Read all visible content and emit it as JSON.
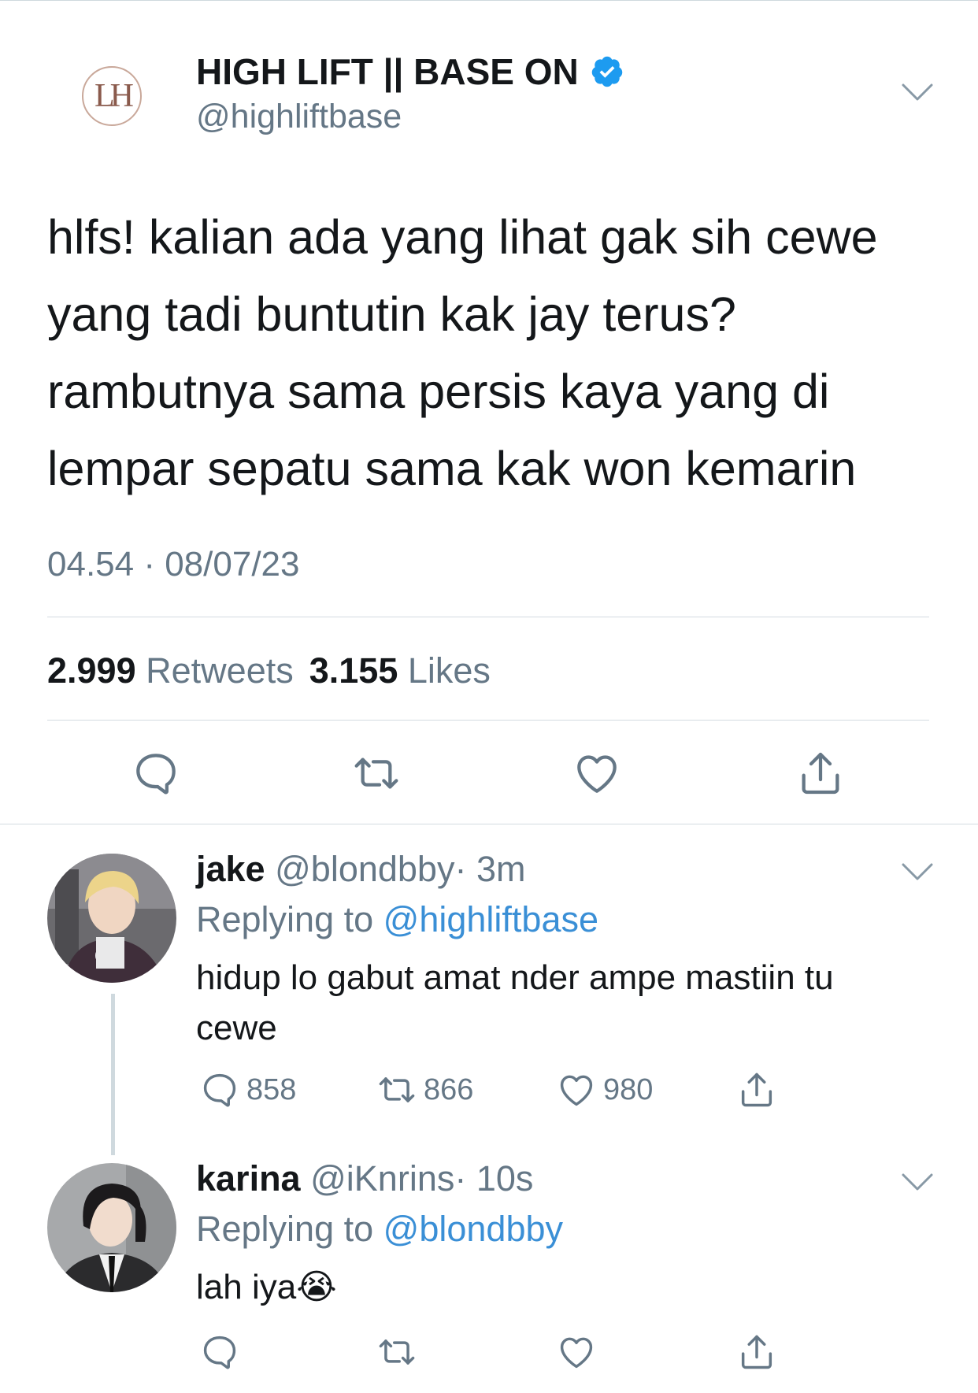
{
  "main_tweet": {
    "avatar_letters": "LH",
    "display_name": "HIGH LIFT || BASE ON",
    "handle": "@highliftbase",
    "text": "hlfs! kalian ada yang lihat gak sih cewe yang tadi buntutin kak jay terus? rambutnya sama persis kaya yang di lempar sepatu sama kak won kemarin",
    "timestamp": "04.54 · 08/07/23",
    "retweets_count": "2.999",
    "retweets_label": "Retweets",
    "likes_count": "3.155",
    "likes_label": "Likes",
    "icons": [
      "reply-icon",
      "retweet-icon",
      "like-icon",
      "share-icon",
      "verified-badge-icon",
      "chevron-down-icon"
    ]
  },
  "replies": [
    {
      "display_name": "jake",
      "handle": "@blondbby",
      "time": "· 3m",
      "replying_prefix": "Replying to",
      "replying_to": "@highliftbase",
      "text": "hidup lo gabut amat nder ampe mastiin tu cewe",
      "reply_count": "858",
      "retweet_count": "866",
      "like_count": "980",
      "avatar_jacket_text": "GU"
    },
    {
      "display_name": "karina",
      "handle": "@iKnrins",
      "time": "· 10s",
      "replying_prefix": "Replying to",
      "replying_to": "@blondbby",
      "text": "lah iya😭"
    }
  ],
  "colors": {
    "text": "#14171a",
    "secondary": "#657786",
    "link": "#3a8fd6",
    "verified": "#1d9bf0",
    "divider": "#d3dbe1"
  }
}
